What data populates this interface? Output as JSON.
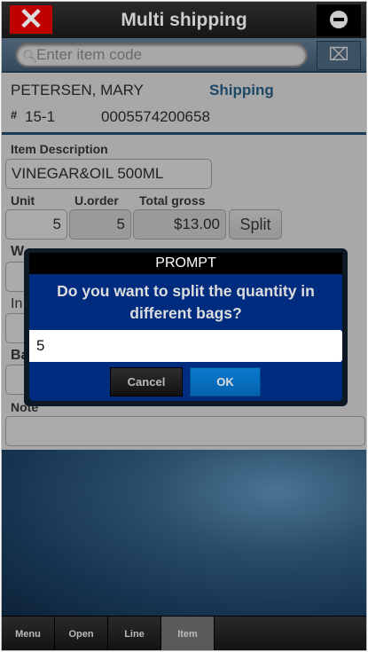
{
  "header": {
    "title": "Multi shipping",
    "close_icon": "✕"
  },
  "search": {
    "placeholder": "Enter item code",
    "scan_icon": "⌧"
  },
  "customer": {
    "name": "PETERSEN, MARY",
    "status": "Shipping",
    "hash": "#",
    "order": "15-1",
    "code": "0005574200658"
  },
  "form": {
    "desc_label": "Item Description",
    "desc_value": "VINEGAR&OIL 500ML",
    "unit_label": "Unit",
    "unit_value": "5",
    "uorder_label": "U.order",
    "uorder_value": "5",
    "gross_label": "Total gross",
    "gross_value": "$13.00",
    "split_label": "Split",
    "hidden_label_1": "W",
    "hidden_label_2": "In",
    "hidden_label_3": "Ba",
    "note_label": "Note",
    "note_value": ""
  },
  "dialog": {
    "title": "PROMPT",
    "message": "Do you want to split the quantity in different bags?",
    "input_value": "5",
    "cancel_label": "Cancel",
    "ok_label": "OK"
  },
  "tabs": [
    {
      "label": "Menu"
    },
    {
      "label": "Open"
    },
    {
      "label": "Line"
    },
    {
      "label": "Item",
      "active": true
    }
  ]
}
